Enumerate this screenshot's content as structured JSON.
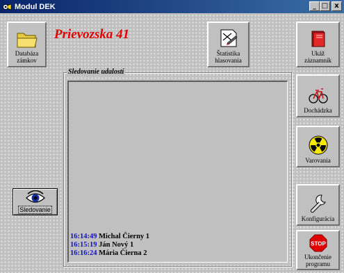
{
  "window": {
    "title": "Modul DEK",
    "minimize": "_",
    "maximize": "□",
    "close": "x"
  },
  "heading": "Prievozska 41",
  "buttons": {
    "databaza": [
      "Databáza",
      "zámkov"
    ],
    "statistika": [
      "Štatistika",
      "hlasovania"
    ],
    "zaznamnik": [
      "Ukáž",
      "záznamník"
    ],
    "dochadzka": [
      "Dochádzka"
    ],
    "varovania": [
      "Varovania"
    ],
    "konfiguracia": [
      "Konfigurácia"
    ],
    "ukoncenie": [
      "Ukončenie",
      "programu"
    ],
    "sledovanie": "Sledovanie"
  },
  "stop_sign_text": "STOP",
  "events_panel": {
    "title": "Sledovanie udalostí",
    "events": [
      {
        "time": "16:14:49",
        "name": "Michal Čierny 1"
      },
      {
        "time": "16:15:19",
        "name": "Ján Nový 1"
      },
      {
        "time": "16:16:24",
        "name": "Mária Čierna 2"
      }
    ]
  },
  "colors": {
    "title_bar": "#0a246a",
    "heading": "#e00000",
    "event_time": "#1010c8"
  }
}
